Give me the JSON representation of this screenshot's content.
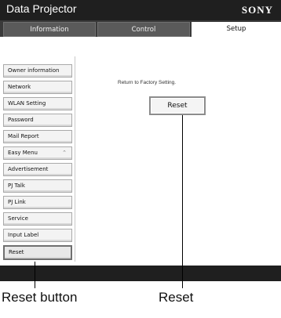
{
  "app_title": "Data Projector",
  "brand": "SONY",
  "tabs": [
    {
      "label": "Information"
    },
    {
      "label": "Control"
    },
    {
      "label": "Setup"
    }
  ],
  "sidebar": {
    "items": [
      {
        "label": "Owner information"
      },
      {
        "label": "Network"
      },
      {
        "label": "WLAN Setting"
      },
      {
        "label": "Password"
      },
      {
        "label": "Mail Report"
      },
      {
        "label": "Easy Menu",
        "icon": "chevron-up-icon",
        "icon_glyph": "⌃"
      },
      {
        "label": "Advertisement"
      },
      {
        "label": "PJ Talk"
      },
      {
        "label": "PJ Link"
      },
      {
        "label": "Service"
      },
      {
        "label": "Input Label"
      },
      {
        "label": "Reset"
      }
    ]
  },
  "main": {
    "message": "Return to Factory Setting.",
    "reset_label": "Reset"
  },
  "callouts": [
    {
      "label": "Reset button"
    },
    {
      "label": "Reset"
    }
  ]
}
